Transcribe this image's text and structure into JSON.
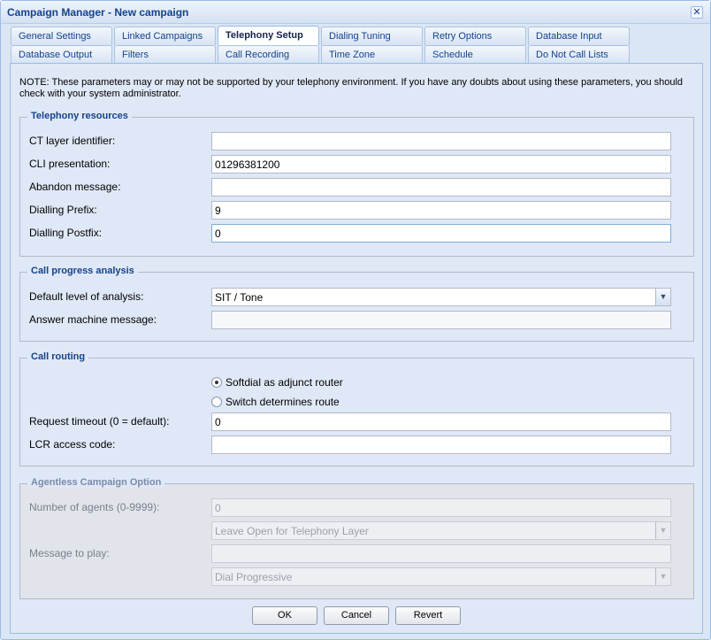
{
  "window": {
    "title": "Campaign Manager - New campaign",
    "close_symbol": "✕"
  },
  "tabs_row1": [
    "General Settings",
    "Linked Campaigns",
    "Telephony Setup",
    "Dialing Tuning",
    "Retry Options",
    "Database Input"
  ],
  "tabs_row2": [
    "Database Output",
    "Filters",
    "Call Recording",
    "Time Zone",
    "Schedule",
    "Do Not Call Lists"
  ],
  "active_tab": "Telephony Setup",
  "note": "NOTE: These parameters may or may not be supported by your telephony environment. If you have any doubts about using these parameters, you should check with your system administrator.",
  "telephony": {
    "legend": "Telephony resources",
    "ct_layer_label": "CT layer identifier:",
    "ct_layer_value": "",
    "cli_label": "CLI presentation:",
    "cli_value": "01296381200",
    "abandon_label": "Abandon message:",
    "abandon_value": "",
    "prefix_label": "Dialling Prefix:",
    "prefix_value": "9",
    "postfix_label": "Dialling Postfix:",
    "postfix_value": "0"
  },
  "cpa": {
    "legend": "Call progress analysis",
    "level_label": "Default level of analysis:",
    "level_value": "SIT / Tone",
    "answer_label": "Answer machine message:",
    "answer_value": ""
  },
  "routing": {
    "legend": "Call routing",
    "radio1": "Softdial as adjunct router",
    "radio1_checked": true,
    "radio2": "Switch determines route",
    "radio2_checked": false,
    "timeout_label": "Request timeout (0 = default):",
    "timeout_value": "0",
    "lcr_label": "LCR access code:",
    "lcr_value": ""
  },
  "agentless": {
    "legend": "Agentless Campaign Option",
    "agents_label": "Number of agents (0-9999):",
    "agents_value": "0",
    "leave_open_value": "Leave Open for Telephony Layer",
    "message_label": "Message to play:",
    "message_value": "",
    "dial_mode_value": "Dial Progressive"
  },
  "buttons": {
    "ok": "OK",
    "cancel": "Cancel",
    "revert": "Revert"
  },
  "icons": {
    "dropdown": "▼"
  },
  "colors": {
    "accent": "#15428b",
    "border": "#99bbe8",
    "panel": "#dfe8f6"
  }
}
